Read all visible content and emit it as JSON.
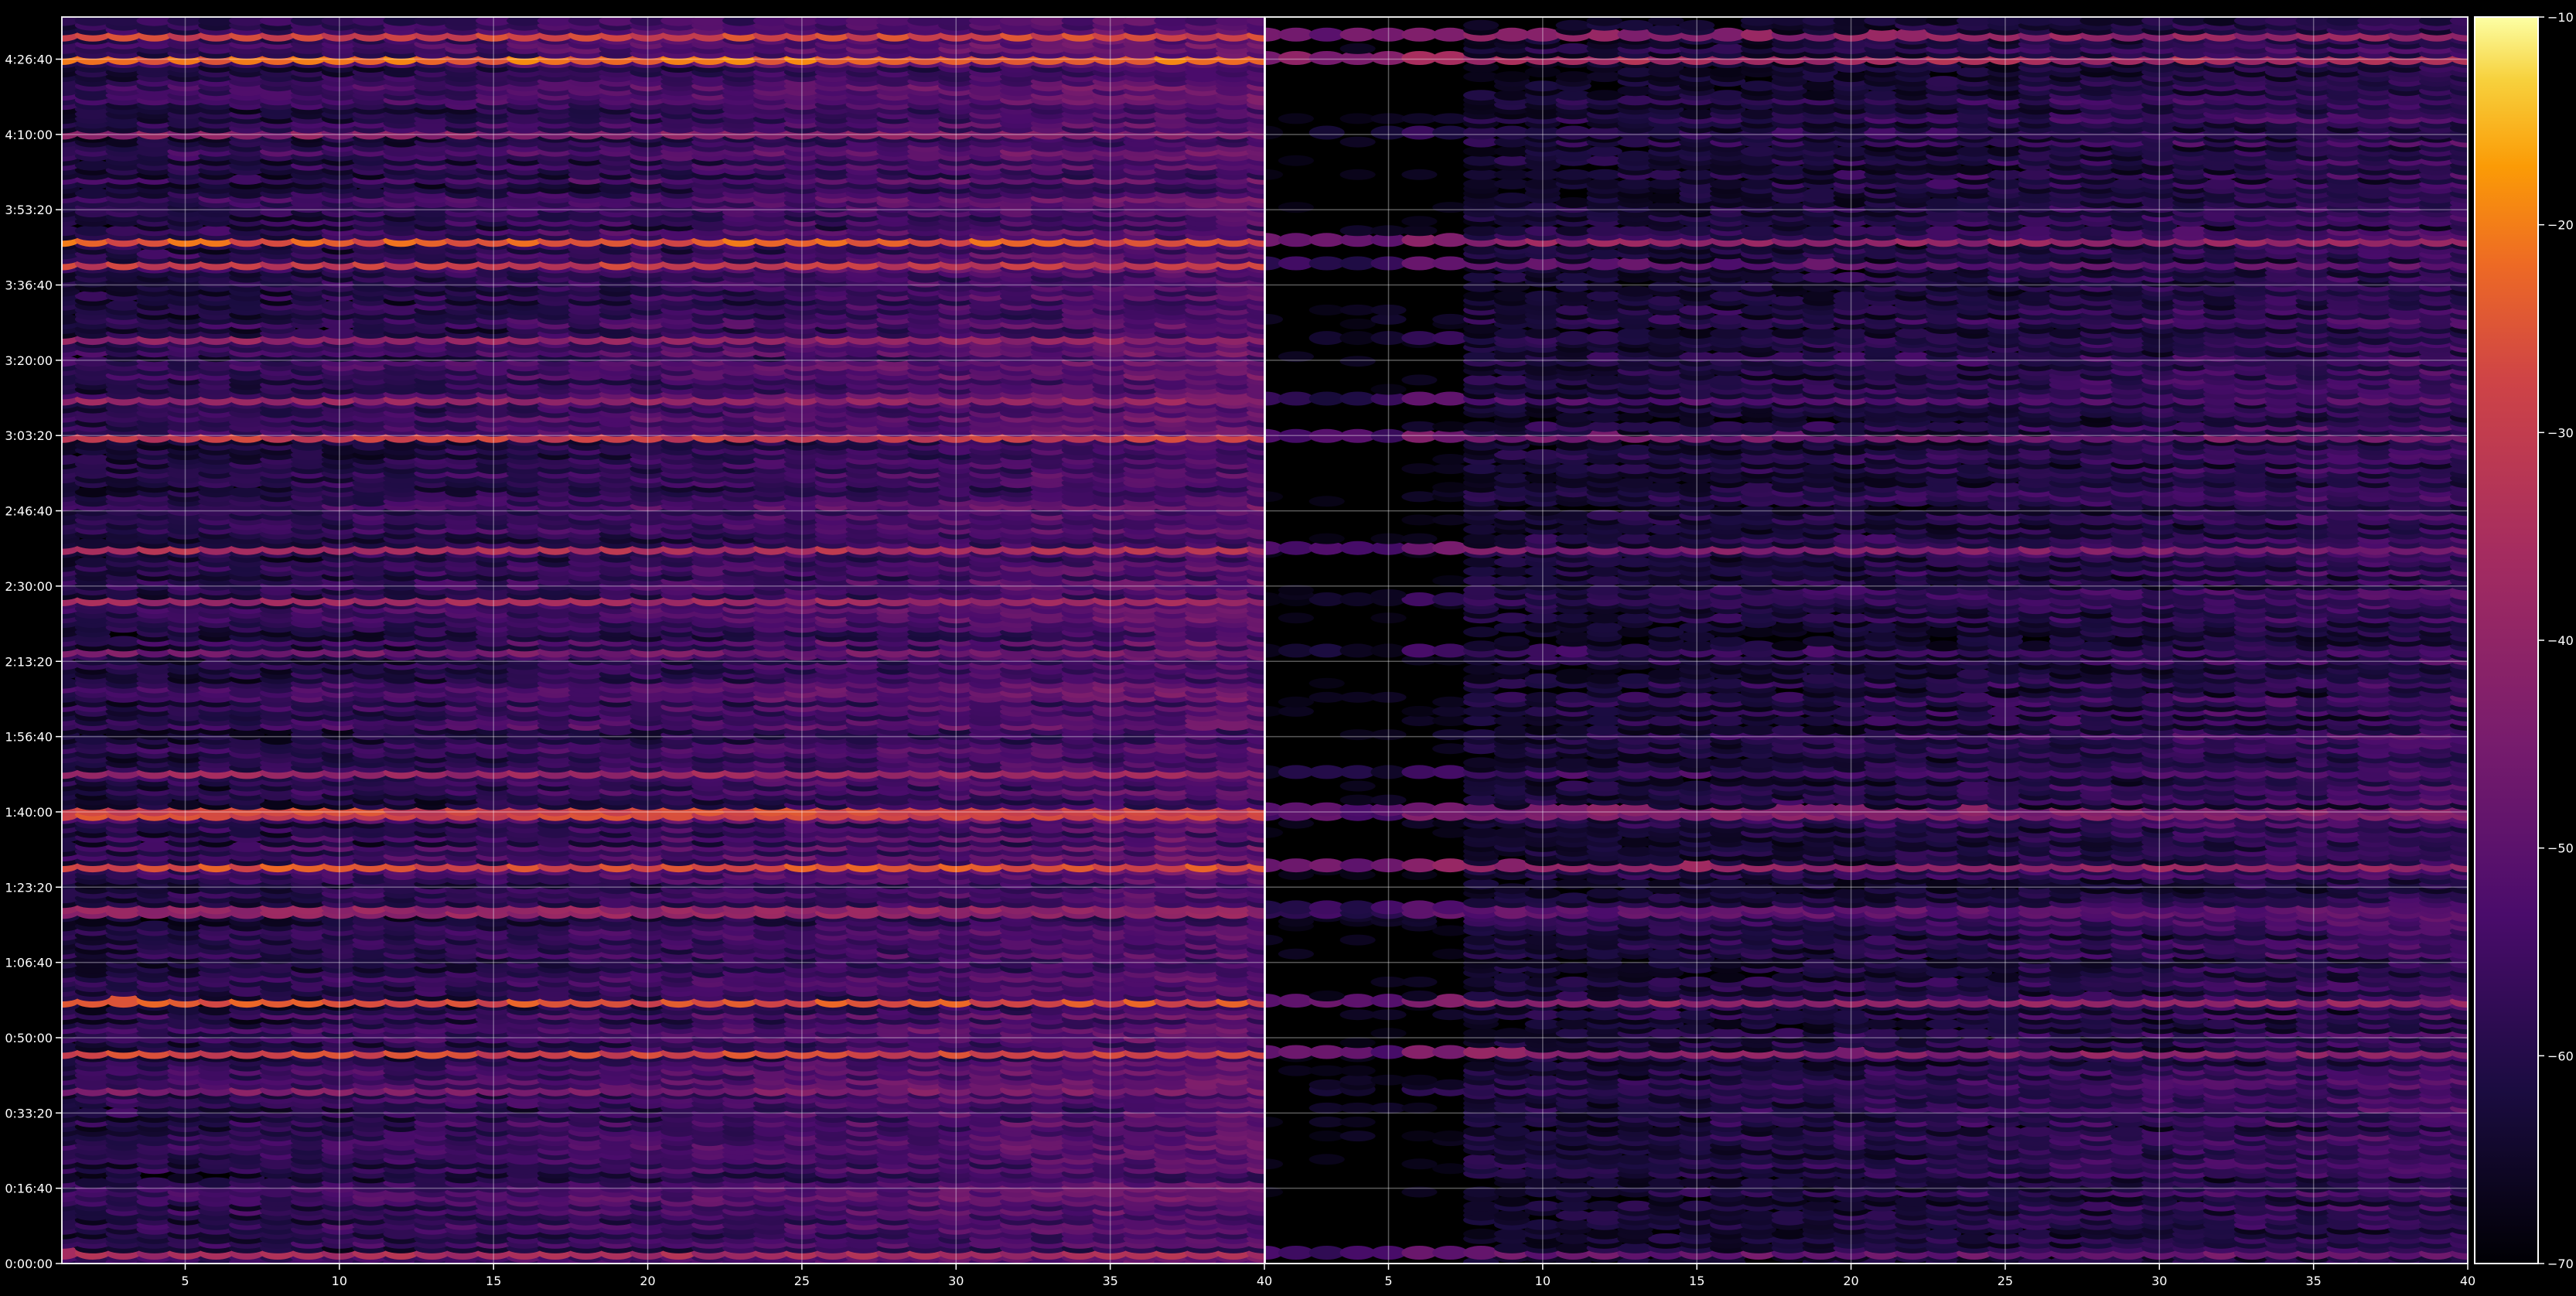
{
  "chart_data": {
    "type": "heatmap",
    "title": "",
    "xlabel": "",
    "ylabel": "",
    "panels": [
      {
        "name": "",
        "x_range": [
          1,
          40
        ],
        "x_ticks": [
          5,
          10,
          15,
          20,
          25,
          30,
          35,
          40
        ],
        "x_tick_labels": [
          "5",
          "10",
          "15",
          "20",
          "25",
          "30",
          "35",
          "40"
        ]
      },
      {
        "name": "",
        "x_range": [
          1,
          40
        ],
        "x_ticks": [
          5,
          10,
          15,
          20,
          25,
          30,
          35,
          40
        ],
        "x_tick_labels": [
          "5",
          "10",
          "15",
          "20",
          "25",
          "30",
          "35",
          "40"
        ]
      }
    ],
    "y_range_seconds": [
      0,
      16560
    ],
    "y_ticks_seconds": [
      0,
      1000,
      2000,
      3000,
      4000,
      5000,
      6000,
      7000,
      8000,
      9000,
      10000,
      11000,
      12000,
      13000,
      14000,
      15000,
      16000
    ],
    "y_tick_labels": [
      "0:00:00",
      "0:16:40",
      "0:33:20",
      "0:50:00",
      "1:06:40",
      "1:23:20",
      "1:40:00",
      "1:56:40",
      "2:13:20",
      "2:30:00",
      "2:46:40",
      "3:03:20",
      "3:20:00",
      "3:36:40",
      "3:53:20",
      "4:10:00",
      "4:26:40"
    ],
    "grid": true,
    "colormap": "inferno",
    "colorbar": {
      "range": [
        -70,
        -10
      ],
      "ticks": [
        -70,
        -60,
        -50,
        -40,
        -30,
        -20,
        -10
      ],
      "tick_labels": [
        "−70",
        "−60",
        "−50",
        "−40",
        "−30",
        "−20",
        "−10"
      ]
    },
    "strong_rows": [
      {
        "t": 16350,
        "left": -26,
        "right": -38
      },
      {
        "t": 16000,
        "left": -20,
        "right": -34
      },
      {
        "t": 15000,
        "left": -40,
        "right": -56
      },
      {
        "t": 13600,
        "left": -22,
        "right": -38
      },
      {
        "t": 13300,
        "left": -28,
        "right": -48
      },
      {
        "t": 12300,
        "left": -38,
        "right": -58
      },
      {
        "t": 11500,
        "left": -38,
        "right": -50
      },
      {
        "t": 11000,
        "left": -28,
        "right": -44
      },
      {
        "t": 9500,
        "left": -32,
        "right": -42
      },
      {
        "t": 8800,
        "left": -36,
        "right": -56
      },
      {
        "t": 8150,
        "left": -44,
        "right": -54
      },
      {
        "t": 6550,
        "left": -36,
        "right": -52
      },
      {
        "t": 6000,
        "left": -26,
        "right": -42
      },
      {
        "t": 5300,
        "left": -24,
        "right": -38
      },
      {
        "t": 4700,
        "left": -38,
        "right": -48
      },
      {
        "t": 3500,
        "left": -24,
        "right": -38
      },
      {
        "t": 2800,
        "left": -26,
        "right": -40
      },
      {
        "t": 2300,
        "left": -42,
        "right": -56
      },
      {
        "t": 150,
        "left": -34,
        "right": -46
      }
    ]
  }
}
